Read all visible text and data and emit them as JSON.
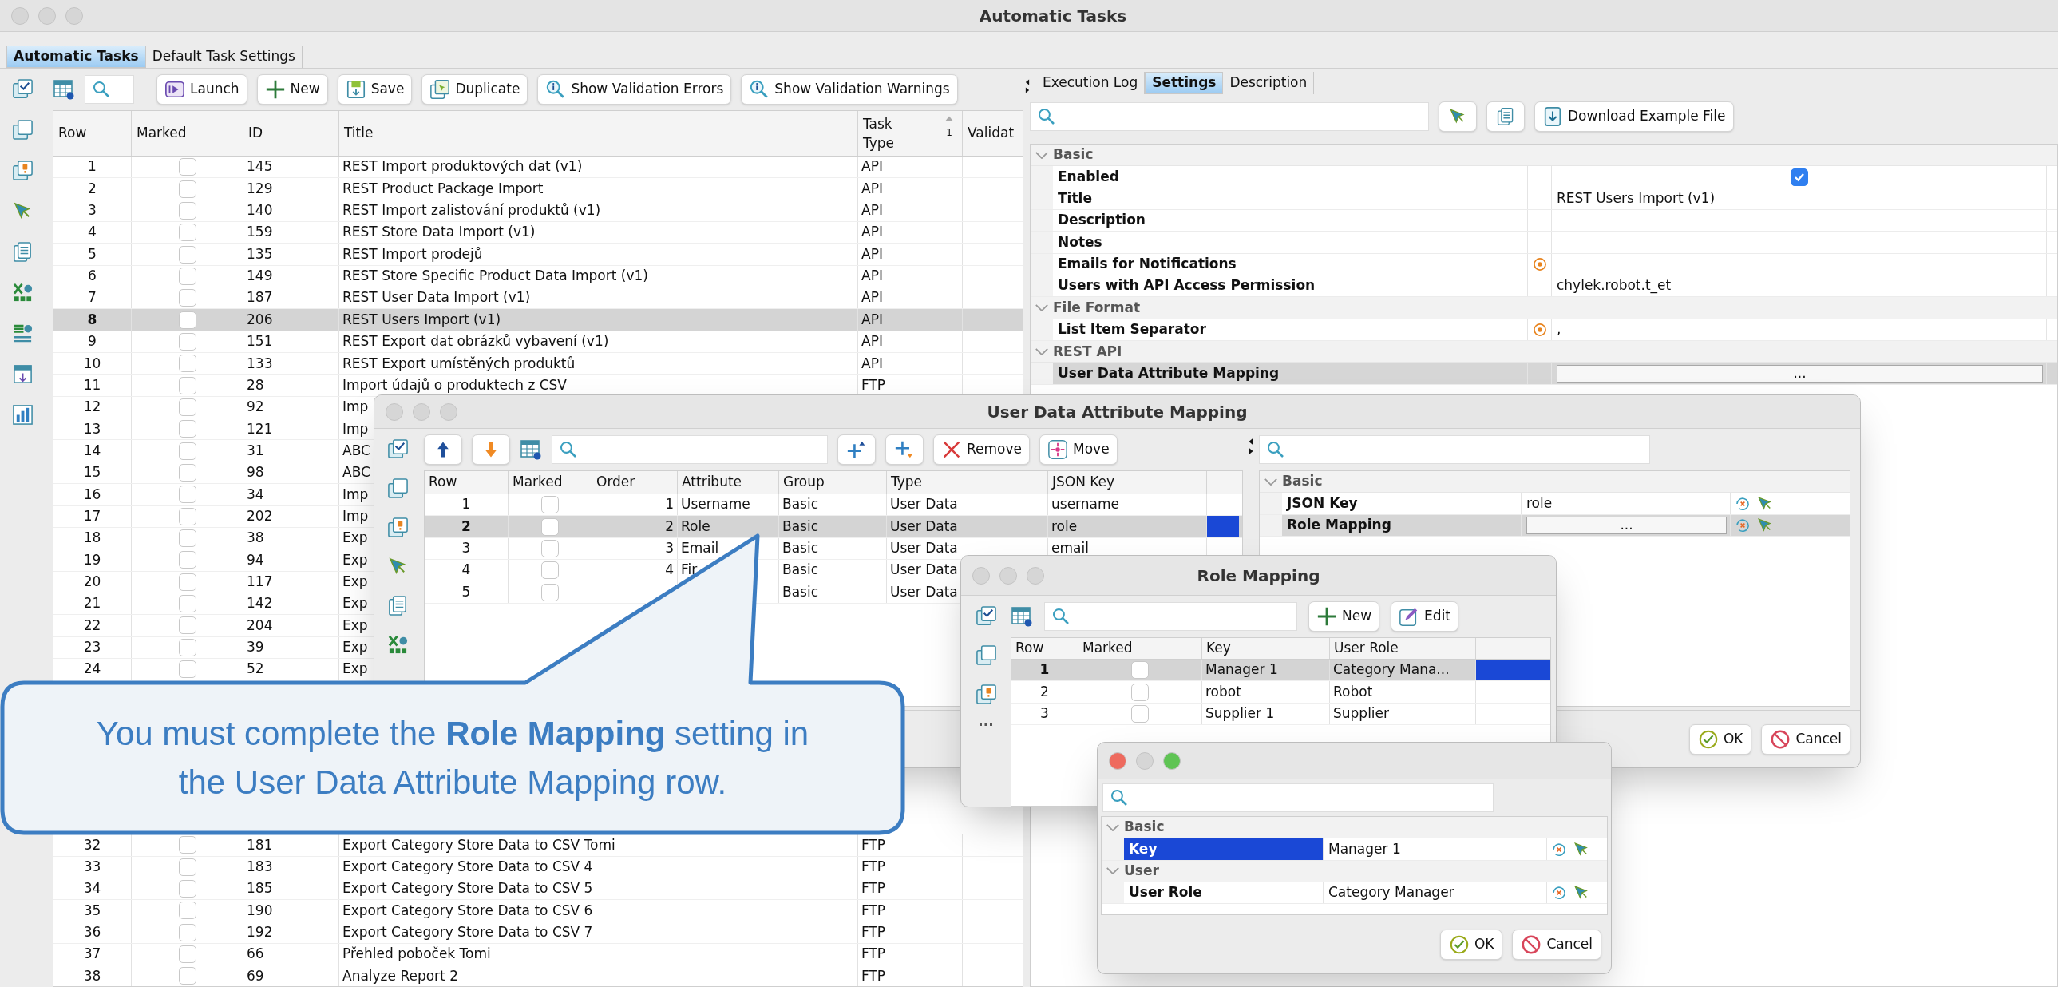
{
  "window": {
    "title": "Automatic Tasks"
  },
  "tabs": [
    {
      "label": "Automatic Tasks",
      "selected": true
    },
    {
      "label": "Default Task Settings",
      "selected": false
    }
  ],
  "toolbar": {
    "buttons": [
      "Launch",
      "New",
      "Save",
      "Duplicate",
      "Show Validation Errors",
      "Show Validation Warnings"
    ]
  },
  "table": {
    "columns": [
      "Row",
      "Marked",
      "ID",
      "Title",
      "Task Type",
      "Validat"
    ],
    "sort_index": "1",
    "rows_top": [
      {
        "row": "1",
        "marked": false,
        "selected": false,
        "id": "145",
        "title": "REST Import produktových dat (v1)",
        "type": "API"
      },
      {
        "row": "2",
        "marked": false,
        "selected": false,
        "id": "129",
        "title": "REST Product Package Import",
        "type": "API"
      },
      {
        "row": "3",
        "marked": false,
        "selected": false,
        "id": "140",
        "title": "REST Import zalistování produktů (v1)",
        "type": "API"
      },
      {
        "row": "4",
        "marked": false,
        "selected": false,
        "id": "159",
        "title": "REST Store Data Import (v1)",
        "type": "API"
      },
      {
        "row": "5",
        "marked": false,
        "selected": false,
        "id": "135",
        "title": "REST Import prodejů",
        "type": "API"
      },
      {
        "row": "6",
        "marked": false,
        "selected": false,
        "id": "149",
        "title": "REST Store Specific Product Data Import (v1)",
        "type": "API"
      },
      {
        "row": "7",
        "marked": false,
        "selected": false,
        "id": "187",
        "title": "REST User Data Import (v1)",
        "type": "API"
      },
      {
        "row": "8",
        "marked": false,
        "selected": true,
        "id": "206",
        "title": "REST Users Import (v1)",
        "type": "API"
      },
      {
        "row": "9",
        "marked": false,
        "selected": false,
        "id": "151",
        "title": "REST Export dat obrázků vybavení (v1)",
        "type": "API"
      },
      {
        "row": "10",
        "marked": false,
        "selected": false,
        "id": "133",
        "title": "REST Export umístěných produktů",
        "type": "API"
      },
      {
        "row": "11",
        "marked": false,
        "selected": false,
        "id": "28",
        "title": "Import údajů o produktech z CSV",
        "type": "FTP"
      },
      {
        "row": "12",
        "marked": false,
        "selected": false,
        "id": "92",
        "title": "Imp"
      },
      {
        "row": "13",
        "marked": false,
        "selected": false,
        "id": "121",
        "title": "Imp"
      },
      {
        "row": "14",
        "marked": false,
        "selected": false,
        "id": "31",
        "title": "ABC"
      },
      {
        "row": "15",
        "marked": false,
        "selected": false,
        "id": "98",
        "title": "ABC"
      },
      {
        "row": "16",
        "marked": false,
        "selected": false,
        "id": "34",
        "title": "Imp"
      },
      {
        "row": "17",
        "marked": false,
        "selected": false,
        "id": "202",
        "title": "Imp"
      },
      {
        "row": "18",
        "marked": false,
        "selected": false,
        "id": "38",
        "title": "Exp"
      },
      {
        "row": "19",
        "marked": false,
        "selected": false,
        "id": "94",
        "title": "Exp"
      },
      {
        "row": "20",
        "marked": false,
        "selected": false,
        "id": "117",
        "title": "Exp"
      },
      {
        "row": "21",
        "marked": false,
        "selected": false,
        "id": "142",
        "title": "Exp"
      },
      {
        "row": "22",
        "marked": false,
        "selected": false,
        "id": "204",
        "title": "Exp"
      },
      {
        "row": "23",
        "marked": false,
        "selected": false,
        "id": "39",
        "title": "Exp"
      },
      {
        "row": "24",
        "marked": false,
        "selected": false,
        "id": "52",
        "title": "Exp"
      }
    ],
    "rows_bottom": [
      {
        "row": "32",
        "marked": false,
        "selected": false,
        "id": "181",
        "title": "Export Category Store Data to CSV Tomi",
        "type": "FTP"
      },
      {
        "row": "33",
        "marked": false,
        "selected": false,
        "id": "183",
        "title": "Export Category Store Data to CSV 4",
        "type": "FTP"
      },
      {
        "row": "34",
        "marked": false,
        "selected": false,
        "id": "185",
        "title": "Export Category Store Data to CSV 5",
        "type": "FTP"
      },
      {
        "row": "35",
        "marked": false,
        "selected": false,
        "id": "190",
        "title": "Export Category Store Data to CSV 6",
        "type": "FTP"
      },
      {
        "row": "36",
        "marked": false,
        "selected": false,
        "id": "192",
        "title": "Export Category Store Data to CSV 7",
        "type": "FTP"
      },
      {
        "row": "37",
        "marked": false,
        "selected": false,
        "id": "66",
        "title": "Přehled poboček Tomi",
        "type": "FTP"
      },
      {
        "row": "38",
        "marked": false,
        "selected": false,
        "id": "69",
        "title": "Analyze Report 2",
        "type": "FTP"
      }
    ]
  },
  "settings": {
    "tabs": [
      {
        "label": "Execution Log",
        "selected": false
      },
      {
        "label": "Settings",
        "selected": true
      },
      {
        "label": "Description",
        "selected": false
      }
    ],
    "toolbar_buttons": [
      "Download Example File"
    ],
    "properties": [
      {
        "label": "Basic",
        "expanded": true,
        "children": [
          {
            "kind": "checkbox",
            "label": "Enabled",
            "checked": true,
            "flagged": false,
            "selected": false
          },
          {
            "kind": "text",
            "label": "Title",
            "value": "REST Users Import (v1)",
            "flagged": false,
            "selected": false
          },
          {
            "kind": "text",
            "label": "Description",
            "flagged": false,
            "selected": false
          },
          {
            "kind": "text",
            "label": "Notes",
            "flagged": false,
            "selected": false
          },
          {
            "kind": "text",
            "label": "Emails for Notifications",
            "flagged": true,
            "selected": false
          },
          {
            "kind": "text",
            "label": "Users with API Access Permission",
            "value": "chylek.robot.t_et",
            "flagged": false,
            "selected": false
          }
        ]
      },
      {
        "label": "File Format",
        "expanded": true,
        "children": [
          {
            "kind": "text",
            "label": "List Item Separator",
            "value": ",",
            "flagged": true,
            "selected": false
          }
        ]
      },
      {
        "label": "REST API",
        "expanded": true,
        "children": [
          {
            "kind": "button",
            "label": "User Data Attribute Mapping",
            "value": "...",
            "flagged": false,
            "selected": true
          }
        ]
      }
    ]
  },
  "attribute_mapping": {
    "title": "User Data Attribute Mapping",
    "toolbar_buttons": [
      "Remove",
      "Move"
    ],
    "columns": [
      "Row",
      "Marked",
      "Order",
      "Attribute",
      "Group",
      "Type",
      "JSON Key"
    ],
    "rows": [
      {
        "row": "1",
        "marked": false,
        "selected": false,
        "order": "1",
        "attribute": "Username",
        "group": "Basic",
        "type": "User Data",
        "json_key": "username"
      },
      {
        "row": "2",
        "marked": false,
        "selected": true,
        "order": "2",
        "attribute": "Role",
        "group": "Basic",
        "type": "User Data",
        "json_key": "role"
      },
      {
        "row": "3",
        "marked": false,
        "selected": false,
        "order": "3",
        "attribute": "Email",
        "group": "Basic",
        "type": "User Data",
        "json_key": "email"
      },
      {
        "row": "4",
        "marked": false,
        "selected": false,
        "order": "4",
        "attribute": "Fir",
        "group": "Basic",
        "type": "User Data"
      },
      {
        "row": "5",
        "marked": false,
        "selected": false,
        "group": "Basic",
        "type": "User Data"
      }
    ],
    "properties": [
      {
        "label": "Basic",
        "expanded": true,
        "children": [
          {
            "kind": "text",
            "label": "JSON Key",
            "value": "role",
            "selected": false
          },
          {
            "kind": "button",
            "label": "Role Mapping",
            "value": "...",
            "selected": true
          }
        ]
      }
    ],
    "buttons": [
      "OK",
      "Cancel"
    ]
  },
  "role_mapping": {
    "title": "Role Mapping",
    "more": "...",
    "toolbar_buttons": [
      "New",
      "Edit"
    ],
    "columns": [
      "Row",
      "Marked",
      "Key",
      "User Role"
    ],
    "rows": [
      {
        "row": "1",
        "marked": false,
        "selected": true,
        "key": "Manager 1",
        "role": "Category Mana..."
      },
      {
        "row": "2",
        "marked": false,
        "selected": false,
        "key": "robot",
        "role": "Robot"
      },
      {
        "row": "3",
        "marked": false,
        "selected": false,
        "key": "Supplier 1",
        "role": "Supplier"
      }
    ]
  },
  "key_dialog": {
    "properties": [
      {
        "label": "Basic",
        "expanded": true,
        "children": [
          {
            "label": "Key",
            "value": "Manager 1",
            "selected": true
          }
        ]
      },
      {
        "label": "User",
        "expanded": true,
        "children": [
          {
            "label": "User Role",
            "value": "Category Manager",
            "selected": false
          }
        ]
      }
    ],
    "buttons": [
      "OK",
      "Cancel"
    ]
  },
  "callout": {
    "text": "You must complete the **Role Mapping** setting in the User Data Attribute Mapping row."
  }
}
